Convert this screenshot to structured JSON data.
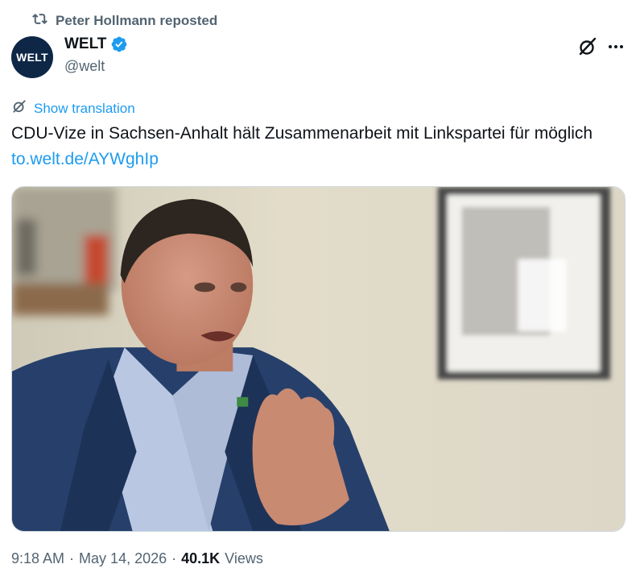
{
  "repost": {
    "label": "Peter Hollmann reposted",
    "icon": "repost-icon"
  },
  "author": {
    "avatar_text": "WELT",
    "name": "WELT",
    "handle": "@welt",
    "verified": true,
    "avatar_color": "#0e2747"
  },
  "actions": {
    "grok_icon": "grok-icon",
    "more_icon": "more-icon"
  },
  "translation": {
    "label": "Show translation"
  },
  "tweet": {
    "text": "CDU-Vize in Sachsen-Anhalt hält Zusammenarbeit mit Linkspartei für möglich",
    "link": "to.welt.de/AYWghIp"
  },
  "media": {
    "type": "photo"
  },
  "meta": {
    "time": "9:18 AM",
    "date": "May 14, 2026",
    "views_count": "40.1K",
    "views_label": "Views",
    "separator": "·"
  },
  "colors": {
    "accent": "#1d9bf0",
    "secondary_text": "#536471",
    "primary_text": "#0f1419"
  }
}
